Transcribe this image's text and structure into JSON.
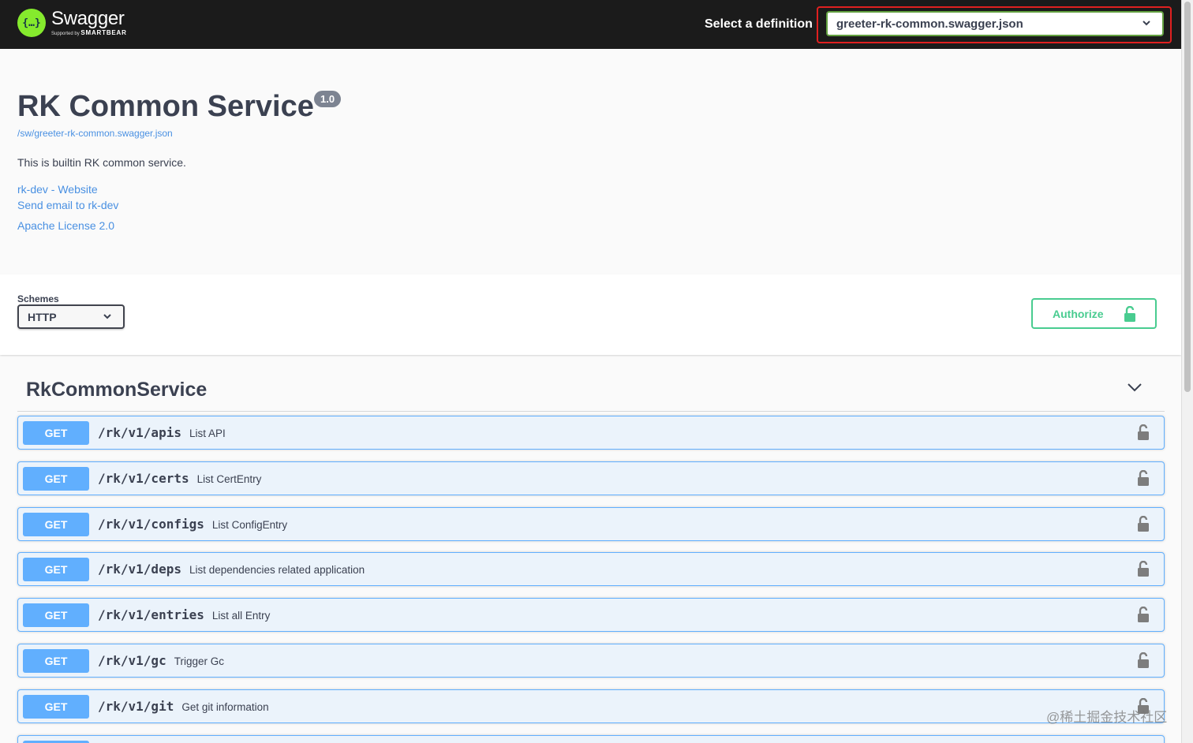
{
  "topbar": {
    "brand_name": "Swagger",
    "brand_sub_prefix": "Supported by",
    "brand_sub_name": "SMARTBEAR",
    "definition_label": "Select a definition",
    "definition_value": "greeter-rk-common.swagger.json"
  },
  "info": {
    "title": "RK Common Service",
    "version": "1.0",
    "spec_url": "/sw/greeter-rk-common.swagger.json",
    "description": "This is builtin RK common service.",
    "contact_website": "rk-dev - Website",
    "contact_email": "Send email to rk-dev",
    "license": "Apache License 2.0"
  },
  "schemes": {
    "label": "Schemes",
    "selected": "HTTP"
  },
  "authorize_label": "Authorize",
  "tag": {
    "name": "RkCommonService"
  },
  "operations": [
    {
      "method": "GET",
      "path": "/rk/v1/apis",
      "summary": "List API"
    },
    {
      "method": "GET",
      "path": "/rk/v1/certs",
      "summary": "List CertEntry"
    },
    {
      "method": "GET",
      "path": "/rk/v1/configs",
      "summary": "List ConfigEntry"
    },
    {
      "method": "GET",
      "path": "/rk/v1/deps",
      "summary": "List dependencies related application"
    },
    {
      "method": "GET",
      "path": "/rk/v1/entries",
      "summary": "List all Entry"
    },
    {
      "method": "GET",
      "path": "/rk/v1/gc",
      "summary": "Trigger Gc"
    },
    {
      "method": "GET",
      "path": "/rk/v1/git",
      "summary": "Get git information"
    }
  ],
  "watermark": "@稀土掘金技术社区",
  "colors": {
    "topbar_bg": "#1b1b1b",
    "logo_green": "#85ea2d",
    "get_blue": "#61affe",
    "get_bg": "#ebf3fb",
    "authorize_green": "#49cc90",
    "link_blue": "#4990e2",
    "highlight_red": "#e02020"
  }
}
